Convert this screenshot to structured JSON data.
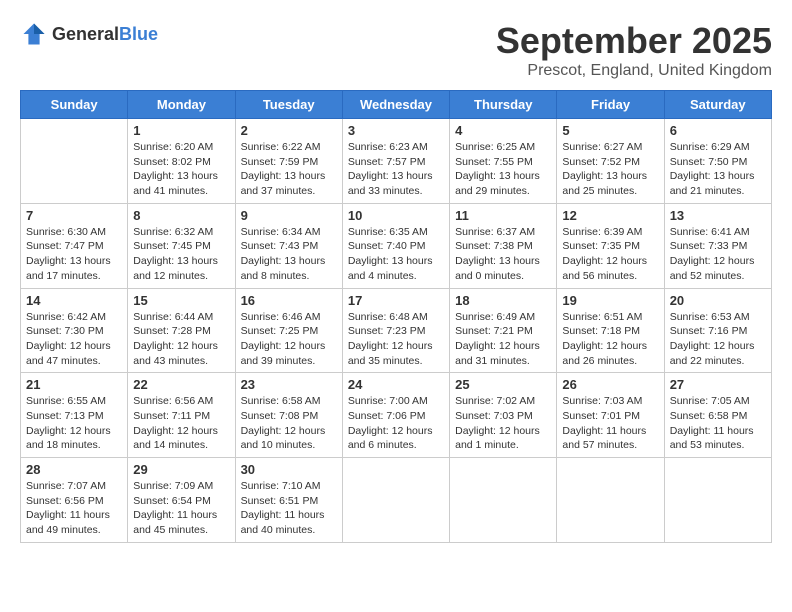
{
  "header": {
    "logo_general": "General",
    "logo_blue": "Blue",
    "month_title": "September 2025",
    "location": "Prescot, England, United Kingdom"
  },
  "weekdays": [
    "Sunday",
    "Monday",
    "Tuesday",
    "Wednesday",
    "Thursday",
    "Friday",
    "Saturday"
  ],
  "weeks": [
    [
      {
        "day": "",
        "info": ""
      },
      {
        "day": "1",
        "info": "Sunrise: 6:20 AM\nSunset: 8:02 PM\nDaylight: 13 hours\nand 41 minutes."
      },
      {
        "day": "2",
        "info": "Sunrise: 6:22 AM\nSunset: 7:59 PM\nDaylight: 13 hours\nand 37 minutes."
      },
      {
        "day": "3",
        "info": "Sunrise: 6:23 AM\nSunset: 7:57 PM\nDaylight: 13 hours\nand 33 minutes."
      },
      {
        "day": "4",
        "info": "Sunrise: 6:25 AM\nSunset: 7:55 PM\nDaylight: 13 hours\nand 29 minutes."
      },
      {
        "day": "5",
        "info": "Sunrise: 6:27 AM\nSunset: 7:52 PM\nDaylight: 13 hours\nand 25 minutes."
      },
      {
        "day": "6",
        "info": "Sunrise: 6:29 AM\nSunset: 7:50 PM\nDaylight: 13 hours\nand 21 minutes."
      }
    ],
    [
      {
        "day": "7",
        "info": "Sunrise: 6:30 AM\nSunset: 7:47 PM\nDaylight: 13 hours\nand 17 minutes."
      },
      {
        "day": "8",
        "info": "Sunrise: 6:32 AM\nSunset: 7:45 PM\nDaylight: 13 hours\nand 12 minutes."
      },
      {
        "day": "9",
        "info": "Sunrise: 6:34 AM\nSunset: 7:43 PM\nDaylight: 13 hours\nand 8 minutes."
      },
      {
        "day": "10",
        "info": "Sunrise: 6:35 AM\nSunset: 7:40 PM\nDaylight: 13 hours\nand 4 minutes."
      },
      {
        "day": "11",
        "info": "Sunrise: 6:37 AM\nSunset: 7:38 PM\nDaylight: 13 hours\nand 0 minutes."
      },
      {
        "day": "12",
        "info": "Sunrise: 6:39 AM\nSunset: 7:35 PM\nDaylight: 12 hours\nand 56 minutes."
      },
      {
        "day": "13",
        "info": "Sunrise: 6:41 AM\nSunset: 7:33 PM\nDaylight: 12 hours\nand 52 minutes."
      }
    ],
    [
      {
        "day": "14",
        "info": "Sunrise: 6:42 AM\nSunset: 7:30 PM\nDaylight: 12 hours\nand 47 minutes."
      },
      {
        "day": "15",
        "info": "Sunrise: 6:44 AM\nSunset: 7:28 PM\nDaylight: 12 hours\nand 43 minutes."
      },
      {
        "day": "16",
        "info": "Sunrise: 6:46 AM\nSunset: 7:25 PM\nDaylight: 12 hours\nand 39 minutes."
      },
      {
        "day": "17",
        "info": "Sunrise: 6:48 AM\nSunset: 7:23 PM\nDaylight: 12 hours\nand 35 minutes."
      },
      {
        "day": "18",
        "info": "Sunrise: 6:49 AM\nSunset: 7:21 PM\nDaylight: 12 hours\nand 31 minutes."
      },
      {
        "day": "19",
        "info": "Sunrise: 6:51 AM\nSunset: 7:18 PM\nDaylight: 12 hours\nand 26 minutes."
      },
      {
        "day": "20",
        "info": "Sunrise: 6:53 AM\nSunset: 7:16 PM\nDaylight: 12 hours\nand 22 minutes."
      }
    ],
    [
      {
        "day": "21",
        "info": "Sunrise: 6:55 AM\nSunset: 7:13 PM\nDaylight: 12 hours\nand 18 minutes."
      },
      {
        "day": "22",
        "info": "Sunrise: 6:56 AM\nSunset: 7:11 PM\nDaylight: 12 hours\nand 14 minutes."
      },
      {
        "day": "23",
        "info": "Sunrise: 6:58 AM\nSunset: 7:08 PM\nDaylight: 12 hours\nand 10 minutes."
      },
      {
        "day": "24",
        "info": "Sunrise: 7:00 AM\nSunset: 7:06 PM\nDaylight: 12 hours\nand 6 minutes."
      },
      {
        "day": "25",
        "info": "Sunrise: 7:02 AM\nSunset: 7:03 PM\nDaylight: 12 hours\nand 1 minute."
      },
      {
        "day": "26",
        "info": "Sunrise: 7:03 AM\nSunset: 7:01 PM\nDaylight: 11 hours\nand 57 minutes."
      },
      {
        "day": "27",
        "info": "Sunrise: 7:05 AM\nSunset: 6:58 PM\nDaylight: 11 hours\nand 53 minutes."
      }
    ],
    [
      {
        "day": "28",
        "info": "Sunrise: 7:07 AM\nSunset: 6:56 PM\nDaylight: 11 hours\nand 49 minutes."
      },
      {
        "day": "29",
        "info": "Sunrise: 7:09 AM\nSunset: 6:54 PM\nDaylight: 11 hours\nand 45 minutes."
      },
      {
        "day": "30",
        "info": "Sunrise: 7:10 AM\nSunset: 6:51 PM\nDaylight: 11 hours\nand 40 minutes."
      },
      {
        "day": "",
        "info": ""
      },
      {
        "day": "",
        "info": ""
      },
      {
        "day": "",
        "info": ""
      },
      {
        "day": "",
        "info": ""
      }
    ]
  ]
}
